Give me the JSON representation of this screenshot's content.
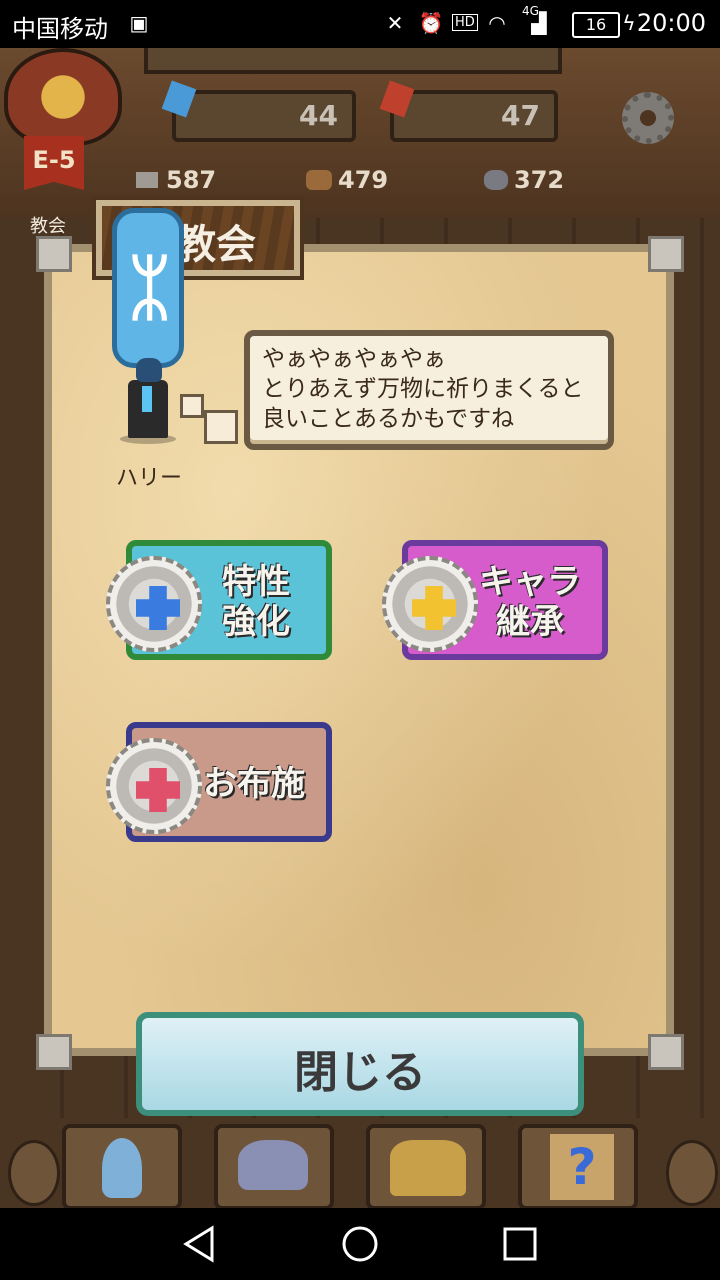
{
  "status_bar": {
    "carrier": "中国移动",
    "battery": "16",
    "time": "20:00",
    "network": "4G",
    "hd": "HD",
    "icons": [
      "notification-icon",
      "mute-icon",
      "alarm-icon",
      "hd-icon",
      "wifi-icon",
      "signal-icon",
      "battery-icon",
      "charging-icon"
    ]
  },
  "hud": {
    "gems_blue": "44",
    "gems_red": "47",
    "materials": [
      {
        "icon": "metal-ingot-icon",
        "value": "587"
      },
      {
        "icon": "wood-logs-icon",
        "value": "479"
      },
      {
        "icon": "stone-icon",
        "value": "372"
      }
    ],
    "floor": "E-5",
    "location": "教会",
    "settings_icon": "gear-icon"
  },
  "panel": {
    "title": "教会",
    "character": {
      "name": "ハリー"
    },
    "speech": "やぁやぁやぁやぁ\nとりあえず万物に祈りまくると\n良いことあるかもですね"
  },
  "actions": [
    {
      "label": "特性\n強化",
      "color": "#5bc3d8",
      "border": "#2f8a3a",
      "cross": "#3a7be0"
    },
    {
      "label": "キャラ\n継承",
      "color": "#d65ccc",
      "border": "#6a3a9c",
      "cross": "#f2c230"
    },
    {
      "label": "お布施",
      "color": "#c99a8a",
      "border": "#3a3a8c",
      "cross": "#e0506a"
    }
  ],
  "close_button": "閉じる",
  "colors": {
    "panel": "#e4c791",
    "close_border": "#3c8f7a"
  }
}
